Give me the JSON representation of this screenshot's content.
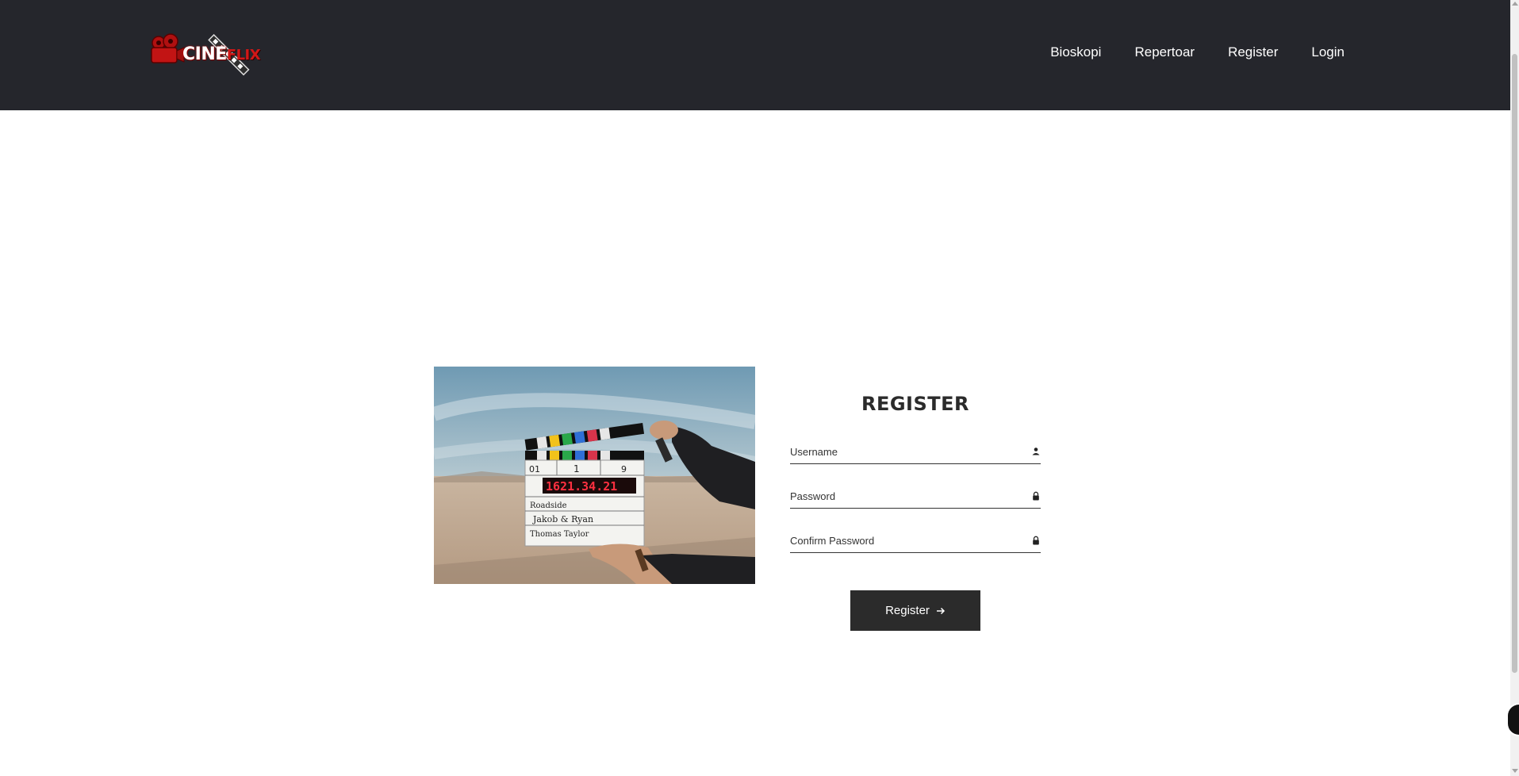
{
  "brand": {
    "logo_text_main": "CINE",
    "logo_text_accent": "FLIX"
  },
  "nav": {
    "items": [
      {
        "label": "Bioskopi"
      },
      {
        "label": "Repertoar"
      },
      {
        "label": "Register"
      },
      {
        "label": "Login"
      }
    ]
  },
  "hero": {
    "slate": {
      "digits": "1621.34.21",
      "roll": "01",
      "scene": "1",
      "take": "9",
      "production": "Roadside",
      "director": "Jakob & Ryan",
      "camera": "Thomas Taylor"
    }
  },
  "form": {
    "title": "REGISTER",
    "username_placeholder": "Username",
    "password_placeholder": "Password",
    "confirm_placeholder": "Confirm Password",
    "submit_label": "Register",
    "submit_icon": "arrow-right-icon",
    "username_icon": "user-icon",
    "password_icon": "lock-icon"
  },
  "colors": {
    "navbar": "#25262c",
    "accent": "#d11717",
    "button": "#2b2b2b"
  }
}
